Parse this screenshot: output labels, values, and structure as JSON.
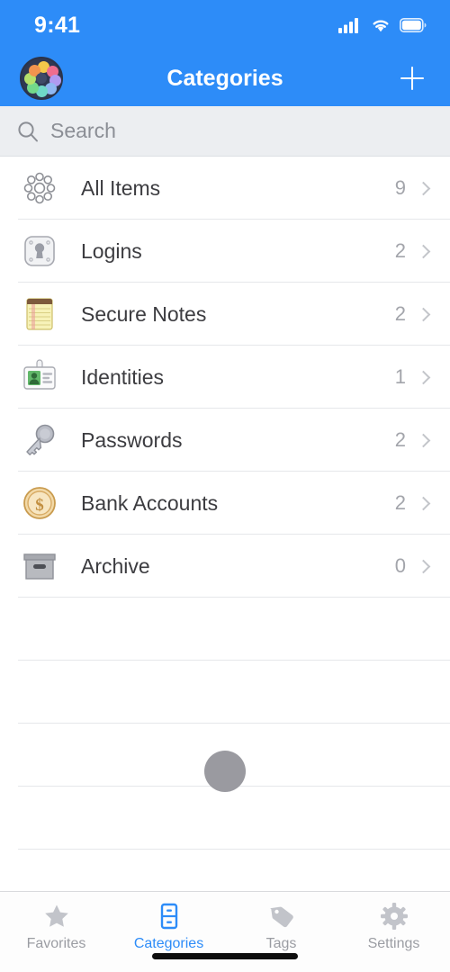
{
  "status_bar": {
    "time": "9:41",
    "icons": [
      "cellular-signal-icon",
      "wifi-icon",
      "battery-icon"
    ]
  },
  "nav_bar": {
    "title": "Categories",
    "app_icon_name": "app-logo-icon",
    "add_button_label": "+",
    "background_color": "#2d8cf8"
  },
  "search": {
    "placeholder": "Search",
    "value": "",
    "icon": "search-icon"
  },
  "categories": [
    {
      "label": "All Items",
      "count": "9",
      "icon": "all-items-icon"
    },
    {
      "label": "Logins",
      "count": "2",
      "icon": "login-keyhole-icon"
    },
    {
      "label": "Secure Notes",
      "count": "2",
      "icon": "notepad-icon"
    },
    {
      "label": "Identities",
      "count": "1",
      "icon": "id-badge-icon"
    },
    {
      "label": "Passwords",
      "count": "2",
      "icon": "key-icon"
    },
    {
      "label": "Bank Accounts",
      "count": "2",
      "icon": "coin-dollar-icon"
    },
    {
      "label": "Archive",
      "count": "0",
      "icon": "archive-box-icon"
    }
  ],
  "loading_indicator": {
    "name": "gray-dot-indicator",
    "color": "#9a9aa0"
  },
  "tab_bar": {
    "active": "Categories",
    "accent_color": "#2d8cf8",
    "inactive_color": "#9b9da3",
    "tabs": [
      {
        "label": "Favorites",
        "icon": "star-icon"
      },
      {
        "label": "Categories",
        "icon": "filing-cabinet-icon"
      },
      {
        "label": "Tags",
        "icon": "tag-icon"
      },
      {
        "label": "Settings",
        "icon": "gear-icon"
      }
    ]
  }
}
